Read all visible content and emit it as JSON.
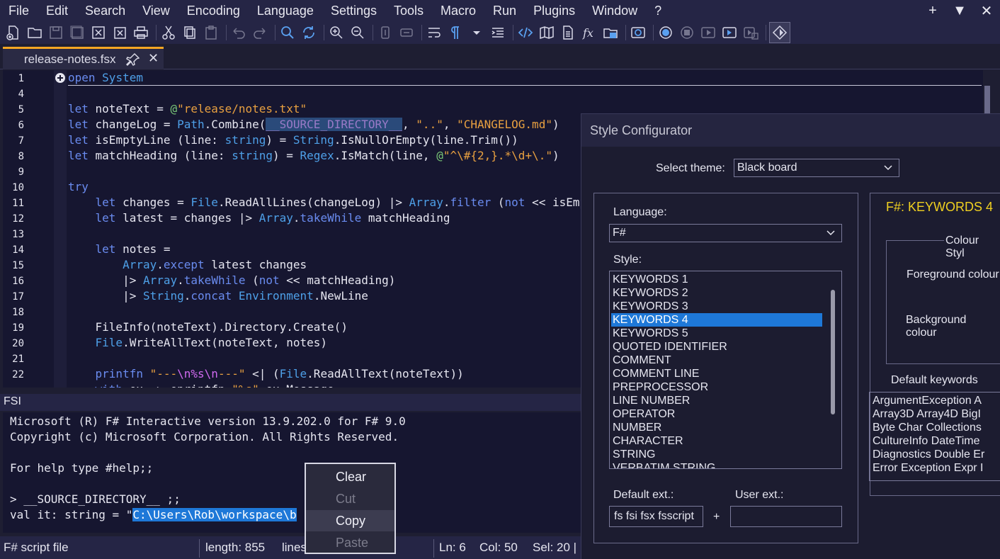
{
  "menu": [
    "File",
    "Edit",
    "Search",
    "View",
    "Encoding",
    "Language",
    "Settings",
    "Tools",
    "Macro",
    "Run",
    "Plugins",
    "Window",
    "?"
  ],
  "window_controls": [
    "+",
    "▼",
    "✕"
  ],
  "tab": {
    "label": "release-notes.fsx",
    "close": "✕"
  },
  "editor": {
    "line_numbers": [
      "1",
      "4",
      "5",
      "6",
      "7",
      "8",
      "9",
      "10",
      "11",
      "12",
      "13",
      "14",
      "15",
      "16",
      "17",
      "18",
      "19",
      "20",
      "21",
      "22"
    ]
  },
  "fsi": {
    "header": "FSI",
    "lines": [
      "Microsoft (R) F# Interactive version 13.9.202.0 for F# 9.0",
      "Copyright (c) Microsoft Corporation. All Rights Reserved.",
      "",
      "For help type #help;;",
      "",
      "> __SOURCE_DIRECTORY__ ;;"
    ],
    "result_prefix": "val it: string = \"",
    "result_selected": "C:\\Users\\Rob\\workspace\\b",
    "result_suffix": "\""
  },
  "statusbar": {
    "file_type": "F# script file",
    "length": "length: 855",
    "lines": "lines",
    "ln": "Ln: 6",
    "col": "Col: 50",
    "sel": "Sel: 20 |"
  },
  "context_menu": {
    "items": [
      {
        "label": "Clear",
        "enabled": true
      },
      {
        "label": "Cut",
        "enabled": false
      },
      {
        "label": "Copy",
        "enabled": true
      },
      {
        "label": "Paste",
        "enabled": false
      }
    ]
  },
  "style_configurator": {
    "title": "Style Configurator",
    "select_theme_label": "Select theme:",
    "theme": "Black board",
    "language_label": "Language:",
    "language": "F#",
    "style_label": "Style:",
    "styles": [
      "KEYWORDS 1",
      "KEYWORDS 2",
      "KEYWORDS 3",
      "KEYWORDS 4",
      "KEYWORDS 5",
      "QUOTED IDENTIFIER",
      "COMMENT",
      "COMMENT LINE",
      "PREPROCESSOR",
      "LINE NUMBER",
      "OPERATOR",
      "NUMBER",
      "CHARACTER",
      "STRING",
      "VERBATIM STRING"
    ],
    "selected_style": "KEYWORDS 4",
    "section_heading": "F#: KEYWORDS 4",
    "colour_style_group": "Colour Styl",
    "foreground_label": "Foreground colour",
    "background_label": "Background colour",
    "default_keywords_label": "Default keywords",
    "default_keywords": [
      "ArgumentException A",
      "Array3D Array4D BigI",
      "Byte Char Collections",
      "CultureInfo DateTime",
      "Diagnostics Double Er",
      "Error Exception Expr I"
    ],
    "default_ext_label": "Default ext.:",
    "default_ext": "fs fsi fsx fsscript",
    "plus": "+",
    "user_ext_label": "User ext.:",
    "user_ext": ""
  },
  "colors": {
    "accent_tab": "#f5a623",
    "selection": "#1e78d8",
    "keyword": "#6a8cf0",
    "string": "#e8a040",
    "heading": "#f0d020"
  }
}
